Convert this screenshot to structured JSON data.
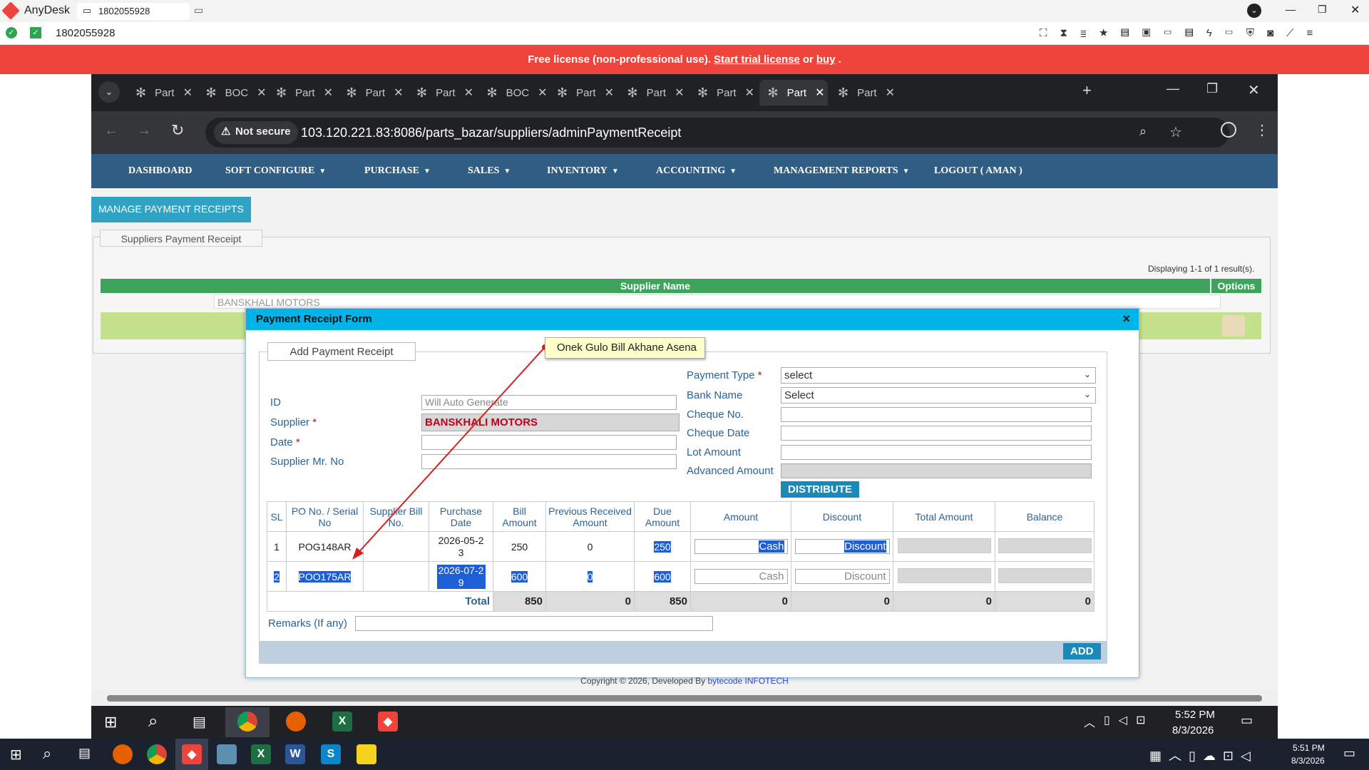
{
  "anydesk": {
    "app_name": "AnyDesk",
    "session_tab": "1802055928",
    "address": "1802055928",
    "banner_text": "Free license (non-professional use).",
    "banner_link1": "Start trial license",
    "banner_or": "or",
    "banner_link2": "buy",
    "banner_end": "."
  },
  "browser": {
    "tabs": [
      {
        "label": "Part"
      },
      {
        "label": "BOC"
      },
      {
        "label": "Part"
      },
      {
        "label": "Part"
      },
      {
        "label": "Part"
      },
      {
        "label": "BOC"
      },
      {
        "label": "Part"
      },
      {
        "label": "Part"
      },
      {
        "label": "Part"
      },
      {
        "label": "Part",
        "active": true
      },
      {
        "label": "Part"
      }
    ],
    "security": "Not secure",
    "url": "103.120.221.83:8086/parts_bazar/suppliers/adminPaymentReceipt"
  },
  "nav": {
    "items": [
      "DASHBOARD",
      "SOFT CONFIGURE",
      "PURCHASE",
      "SALES",
      "INVENTORY",
      "ACCOUNTING",
      "MANAGEMENT REPORTS",
      "LOGOUT ( AMAN )"
    ]
  },
  "page": {
    "manage_button": "MANAGE PAYMENT RECEIPTS",
    "fieldset_legend": "Suppliers Payment Receipt",
    "result_count": "Displaying 1-1 of 1 result(s).",
    "table_headers": {
      "supplier_name": "Supplier Name",
      "options": "Options"
    },
    "filter_value": "BANSKHALI MOTORS"
  },
  "dialog": {
    "title": "Payment Receipt Form",
    "close": "×",
    "legend": "Add Payment Receipt",
    "annotation": "Onek Gulo Bill Akhane Asena",
    "left_fields": {
      "id_label": "ID",
      "id_placeholder": "Will Auto Generate",
      "supplier_label": "Supplier",
      "supplier_value": "BANSKHALI MOTORS",
      "date_label": "Date",
      "mr_label": "Supplier Mr. No"
    },
    "right_fields": {
      "payment_type_label": "Payment Type",
      "payment_type_value": "select",
      "bank_label": "Bank Name",
      "bank_value": "Select",
      "cheque_no_label": "Cheque No.",
      "cheque_date_label": "Cheque Date",
      "lot_amount_label": "Lot Amount",
      "advanced_amount_label": "Advanced Amount"
    },
    "distribute": "DISTRIBUTE",
    "grid_headers": [
      "SL",
      "PO No. / Serial No",
      "Supplier Bill No.",
      "Purchase Date",
      "Bill Amount",
      "Previous Received Amount",
      "Due Amount",
      "Amount",
      "Discount",
      "Total Amount",
      "Balance"
    ],
    "rows": [
      {
        "sl": "1",
        "po": "POG148AR",
        "bill_no": "",
        "date": "2026-05-23",
        "bill": "250",
        "prev": "0",
        "due": "250",
        "amount_ph": "Cash",
        "discount_ph": "Discount"
      },
      {
        "sl": "2",
        "po": "POO175AR",
        "bill_no": "",
        "date": "2026-07-29",
        "bill": "600",
        "prev": "0",
        "due": "600",
        "amount_ph": "Cash",
        "discount_ph": "Discount"
      }
    ],
    "total": {
      "label": "Total",
      "bill": "850",
      "prev": "0",
      "due": "850",
      "amount": "0",
      "discount": "0",
      "total_amount": "0",
      "balance": "0"
    },
    "remarks_label": "Remarks (If any)",
    "add": "ADD"
  },
  "footer": {
    "copyright": "Copyright © 2026, Developed By",
    "company": "bytecode INFOTECH"
  },
  "remote_taskbar": {
    "time": "5:52 PM",
    "date": "8/3/2026"
  },
  "local_taskbar": {
    "time": "5:51 PM",
    "date": "8/3/2026"
  }
}
